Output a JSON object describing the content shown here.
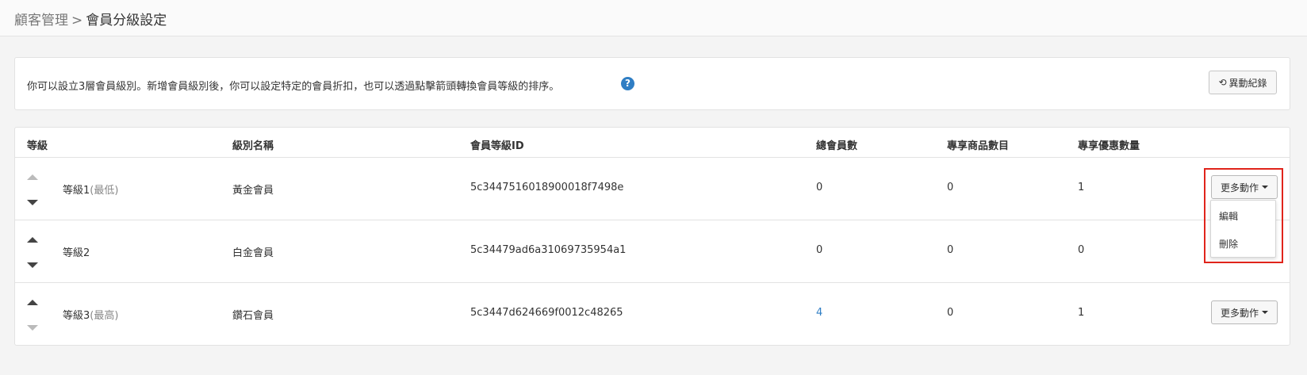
{
  "breadcrumb": {
    "parent": "顧客管理",
    "separator": ">",
    "current": "會員分級設定"
  },
  "info": {
    "text": "你可以設立3層會員級別。新增會員級別後，你可以設定特定的會員折扣，也可以透過點擊箭頭轉換會員等級的排序。",
    "help_icon": "?",
    "history_button": "異動紀錄",
    "history_icon": "⟲"
  },
  "table": {
    "headers": [
      "等級",
      "級別名稱",
      "會員等級ID",
      "總會員數",
      "專享商品數目",
      "專享優惠數量"
    ],
    "rows": [
      {
        "level": "等級1",
        "level_note": "(最低)",
        "name": "黃金會員",
        "id": "5c3447516018900018f7498e",
        "members": "0",
        "products": "0",
        "offers": "1"
      },
      {
        "level": "等級2",
        "level_note": "",
        "name": "白金會員",
        "id": "5c34479ad6a31069735954a1",
        "members": "0",
        "products": "0",
        "offers": "0"
      },
      {
        "level": "等級3",
        "level_note": "(最高)",
        "name": "鑽石會員",
        "id": "5c3447d624669f0012c48265",
        "members": "4",
        "products": "0",
        "offers": "1"
      }
    ],
    "more_actions_label": "更多動作"
  },
  "dropdown": {
    "items": [
      "編輯",
      "刪除"
    ]
  },
  "colors": {
    "accent_link": "#2f7ec4",
    "highlight": "#e0241b"
  },
  "icons": {
    "sort_up": "caret-up-icon",
    "sort_down": "caret-down-icon",
    "help": "question-circle-icon",
    "history": "history-icon"
  }
}
